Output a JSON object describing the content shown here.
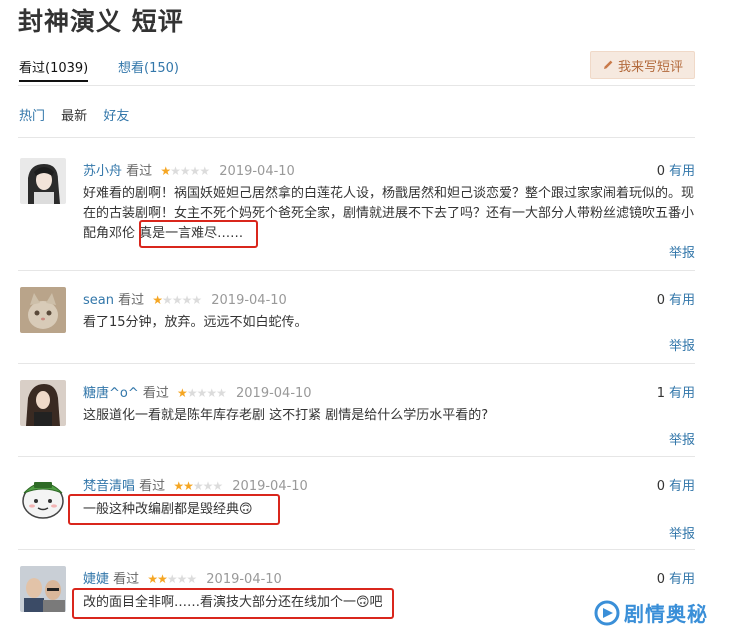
{
  "page": {
    "title": "封神演义 短评"
  },
  "tabs": [
    {
      "label": "看过(1039)",
      "active": true
    },
    {
      "label": "想看(150)",
      "active": false
    }
  ],
  "write_button": {
    "label": "我来写短评",
    "icon": "pencil-icon"
  },
  "filters": {
    "hot": "热门",
    "newest": "最新",
    "friends": "好友"
  },
  "star_colors": {
    "filled": "#f5a623",
    "empty": "#dcdcdc"
  },
  "highlight_color": "#d9261c",
  "comments": [
    {
      "user": "苏小舟",
      "status": "看过",
      "rating": 1,
      "date": "2019-04-10",
      "useful_count": "0",
      "useful_label": "有用",
      "text": "好难看的剧啊！祸国妖姬妲己居然拿的白莲花人设，杨戬居然和妲己谈恋爱？整个跟过家家闹着玩似的。现在的古装剧啊！女主不死个妈死个爸死全家，剧情就进展不下去了吗？还有一大部分人带粉丝滤镜吹五番小配角邓伦 ",
      "text_highlight": "真是一言难尽……",
      "report": "举报"
    },
    {
      "user": "sean",
      "status": "看过",
      "rating": 1,
      "date": "2019-04-10",
      "useful_count": "0",
      "useful_label": "有用",
      "text": "看了15分钟，放弃。远远不如白蛇传。",
      "report": "举报"
    },
    {
      "user": "糖唐^o^",
      "status": "看过",
      "rating": 1,
      "date": "2019-04-10",
      "useful_count": "1",
      "useful_label": "有用",
      "text": "这服道化一看就是陈年库存老剧 这不打紧 剧情是给什么学历水平看的?",
      "report": "举报"
    },
    {
      "user": "梵音清唱",
      "status": "看过",
      "rating": 2,
      "date": "2019-04-10",
      "useful_count": "0",
      "useful_label": "有用",
      "text": "一般这种改编剧都是毁经典🙃",
      "report": "举报"
    },
    {
      "user": "婕婕",
      "status": "看过",
      "rating": 2,
      "date": "2019-04-10",
      "useful_count": "0",
      "useful_label": "有用",
      "text": "改的面目全非啊……看演技大部分还在线加个一🙃吧"
    }
  ],
  "watermark": {
    "text": "剧情奥秘"
  }
}
